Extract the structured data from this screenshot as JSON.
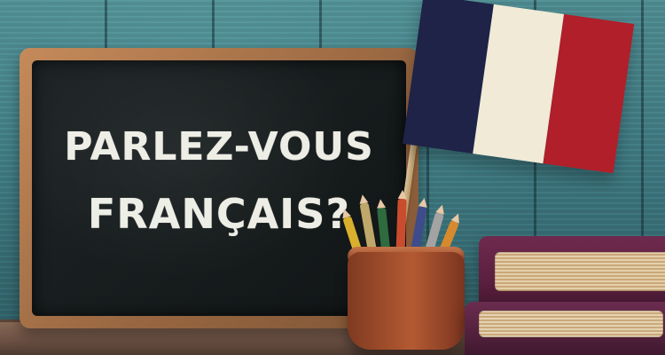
{
  "chalkboard": {
    "line1": "PARLEZ-VOUS",
    "line2": "FRANÇAIS?"
  },
  "objects": {
    "flag": {
      "name": "france-flag",
      "colors": {
        "blue": "#1f2347",
        "white": "#f0ead7",
        "red": "#b01f2a"
      }
    },
    "cup": {
      "name": "pencil-cup"
    },
    "books": {
      "name": "book-stack"
    }
  }
}
